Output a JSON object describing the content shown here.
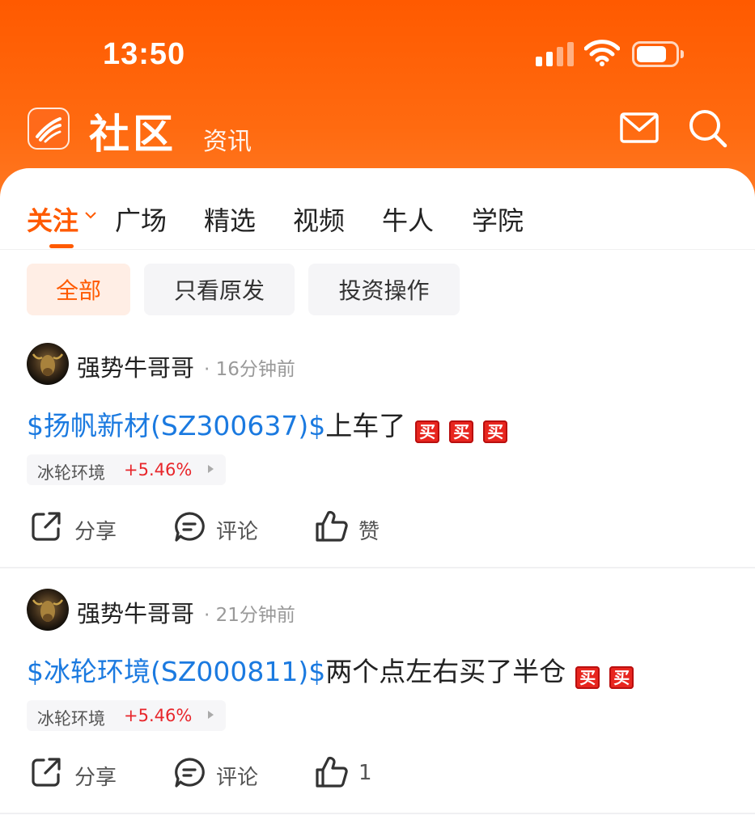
{
  "status_bar": {
    "time": "13:50"
  },
  "header": {
    "title": "社区",
    "subtitle": "资讯",
    "icons": [
      "logo-icon",
      "mail-icon",
      "search-icon"
    ]
  },
  "tabs": [
    {
      "label": "关注",
      "active": true
    },
    {
      "label": "广场"
    },
    {
      "label": "精选"
    },
    {
      "label": "视频"
    },
    {
      "label": "牛人"
    },
    {
      "label": "学院"
    }
  ],
  "filters": [
    {
      "label": "全部",
      "active": true
    },
    {
      "label": "只看原发"
    },
    {
      "label": "投资操作"
    }
  ],
  "posts": [
    {
      "username": "强势牛哥哥",
      "time": "· 16分钟前",
      "stock": "$扬帆新材(SZ300637)$",
      "text": "上车了",
      "badges": [
        "买",
        "买",
        "买"
      ],
      "tag": {
        "name": "冰轮环境",
        "change": "+5.46%"
      },
      "actions": {
        "share": "分享",
        "comment": "评论",
        "like": "赞"
      }
    },
    {
      "username": "强势牛哥哥",
      "time": "· 21分钟前",
      "stock": "$冰轮环境(SZ000811)$",
      "text": "两个点左右买了半仓",
      "badges": [
        "买",
        "买"
      ],
      "tag": {
        "name": "冰轮环境",
        "change": "+5.46%"
      },
      "actions": {
        "share": "分享",
        "comment": "评论",
        "like": "1"
      }
    }
  ],
  "colors": {
    "accent": "#ff5a00",
    "link": "#1b7ae0",
    "rise": "#e8262b"
  }
}
